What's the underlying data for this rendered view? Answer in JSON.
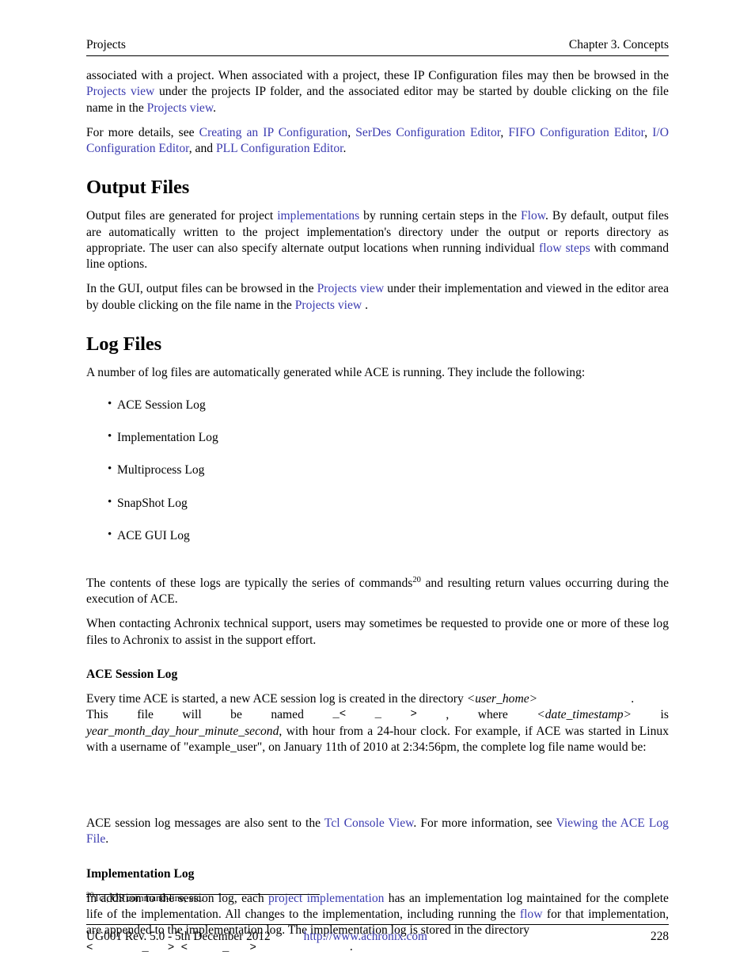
{
  "header": {
    "left": "Projects",
    "right": "Chapter 3. Concepts"
  },
  "intro": {
    "p1_a": "associated with a project. When associated with a project, these IP Configuration files may then be browsed in the ",
    "p1_link1": "Projects view",
    "p1_b": " under the projects IP folder, and the associated editor may be started by double clicking on the file name in the ",
    "p1_link2": "Projects view",
    "p1_c": ".",
    "p2_a": "For more details, see ",
    "p2_link1": "Creating an IP Configuration",
    "p2_sep1": ", ",
    "p2_link2": "SerDes Configuration Editor",
    "p2_sep2": ", ",
    "p2_link3": "FIFO Configuration Editor",
    "p2_sep3": ", ",
    "p2_link4": "I/O Configuration Editor",
    "p2_sep4": ", and ",
    "p2_link5": "PLL Configuration Editor",
    "p2_end": "."
  },
  "output_files": {
    "heading": "Output Files",
    "p1_a": "Output files are generated for project ",
    "p1_link1": "implementations",
    "p1_b": " by running certain steps in the ",
    "p1_link2": "Flow",
    "p1_c": ".  By default, output files are automatically written to the project implementation's directory under the output or reports directory as appropriate.  The user can also specify alternate output locations when running individual ",
    "p1_link3": "flow steps",
    "p1_d": " with command line options.",
    "p2_a": "In the GUI, output files can be browsed in the ",
    "p2_link1": "Projects view",
    "p2_b": " under their implementation and viewed in the editor area by double clicking on the file name in the ",
    "p2_link2": "Projects view",
    "p2_c": " ."
  },
  "log_files": {
    "heading": "Log Files",
    "p1": "A number of log files are automatically generated while ACE is running.  They include the following:",
    "items": [
      "ACE Session Log",
      "Implementation Log",
      "Multiprocess Log",
      "SnapShot Log",
      "ACE GUI Log"
    ],
    "p2_a": "The  contents  of  these  logs  are  typically  the  series  of  commands",
    "p2_sup": "20",
    "p2_b": "  and  resulting  return  values  occurring during the execution of ACE.",
    "p3": "When contacting Achronix technical support, users may sometimes be requested to provide one or more of these log files to Achronix to assist in the support effort."
  },
  "ace_session_log": {
    "heading": "ACE Session Log",
    "p1_a": "Every time ACE is started, a new ACE session log is created in the directory ",
    "p1_var1": "<user_home>",
    "p1_b": ".",
    "p1_line2_words": [
      "This",
      "file",
      "will",
      "be",
      "named",
      "_<",
      "_",
      ">",
      ",",
      "where",
      "<date_timestamp>",
      "is"
    ],
    "p1_italic1": "year_month_day_hour_minute_second",
    "p1_c": ", with hour from a 24-hour clock.   For example, if ACE was started in Linux with a username of \"example_user\", on January 11th of 2010 at 2:34:56pm, the complete log file name would be:",
    "p2_a": "ACE session log messages are also sent to the ",
    "p2_link1": "Tcl Console View",
    "p2_b": ". For more information, see ",
    "p2_link2": "Viewing the ACE Log File",
    "p2_c": "."
  },
  "implementation_log": {
    "heading": "Implementation Log",
    "p1_a": "In addition to the session log, each ",
    "p1_link1": "project implementation",
    "p1_b": " has an implementation log maintained for the complete life of the implementation.  All changes to the implementation, including running the ",
    "p1_link2": "flow",
    "p1_c": " for that implementation, are appended to the implementation log.  The implementation log is stored in the directory",
    "p1_line2_words": [
      "<",
      "_",
      "> <",
      "_",
      ">",
      "."
    ]
  },
  "footnote": {
    "marker": "20",
    "text": "Tcl, OS command-line, etc."
  },
  "footer": {
    "left": "UG001 Rev. 5.0 - 5th December 2012",
    "url": "http://www.achronix.com",
    "page": "228"
  }
}
